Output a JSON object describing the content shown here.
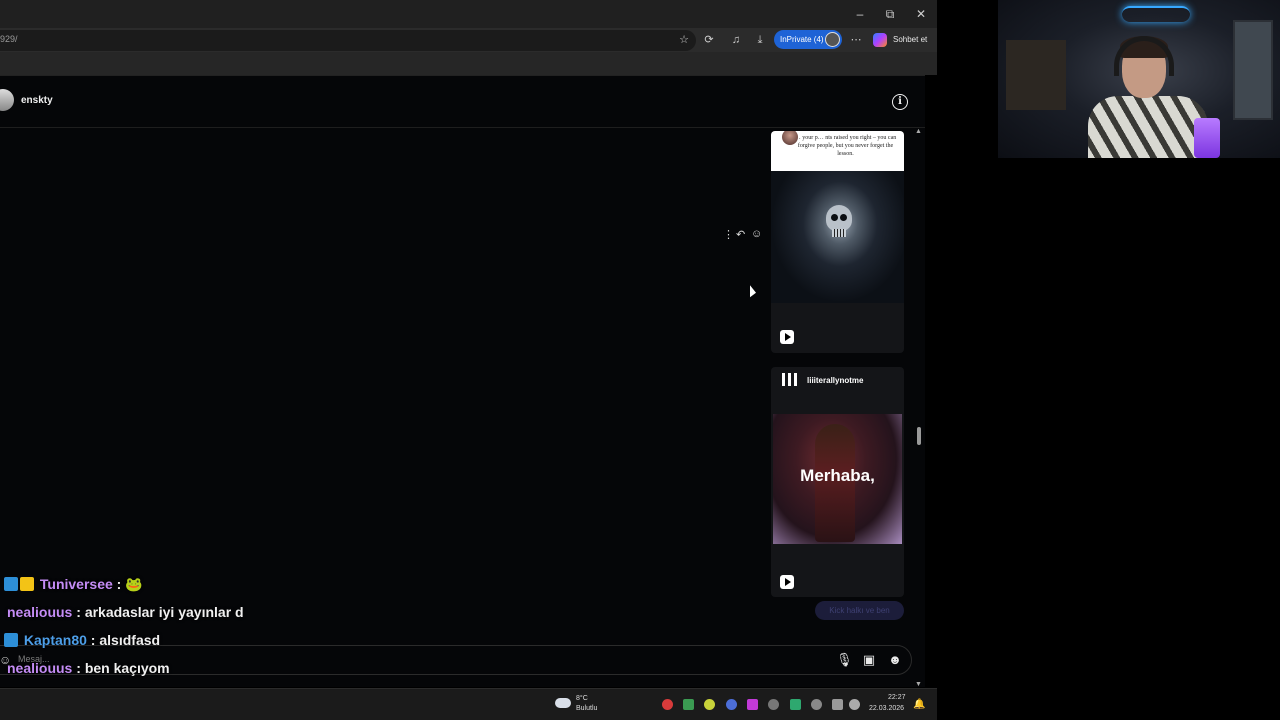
{
  "browser": {
    "url_fragment": "929/",
    "inprivate_label": "InPrivate (4)",
    "copilot_label": "Sohbet et",
    "window_controls": [
      "minimize-icon",
      "restore-icon",
      "close-icon"
    ]
  },
  "chat": {
    "recipient_name": "enskty",
    "composer_placeholder": "Mesaj...",
    "reply_chip": "Kick halkı ve ben"
  },
  "reels": [
    {
      "caption": "… your p… nts raised you right – you can forgive people, but you never forget the lesson."
    },
    {
      "username": "liiiterallynotme",
      "overlay_text": "Merhaba,"
    }
  ],
  "stream_chat": [
    {
      "user": "Tuniversee",
      "sep": " : ",
      "message": "🐸",
      "user_color": "#c48cf5",
      "badges": [
        "prime",
        "crown"
      ]
    },
    {
      "user": "nealiouus",
      "sep": " : ",
      "message": "arkadaslar iyi yayınlar d",
      "user_color": "#c48cf5",
      "badges": []
    },
    {
      "user": "Kaptan80",
      "sep": " : ",
      "message": "alsıdfasd",
      "user_color": "#4d9ee8",
      "badges": [
        "prime"
      ]
    },
    {
      "user": "nealiouus",
      "sep": " : ",
      "message": "ben kaçıyom",
      "user_color": "#c48cf5",
      "badges": []
    }
  ],
  "taskbar": {
    "weather_temp": "8°C",
    "weather_desc": "Bulutlu",
    "time": "22:27",
    "date": "22.03.2026"
  },
  "colors": {
    "accent_inprivate": "#1e63d6",
    "chat_user_purple": "#c48cf5",
    "chat_user_blue": "#4d9ee8",
    "page_bg": "#050608"
  }
}
